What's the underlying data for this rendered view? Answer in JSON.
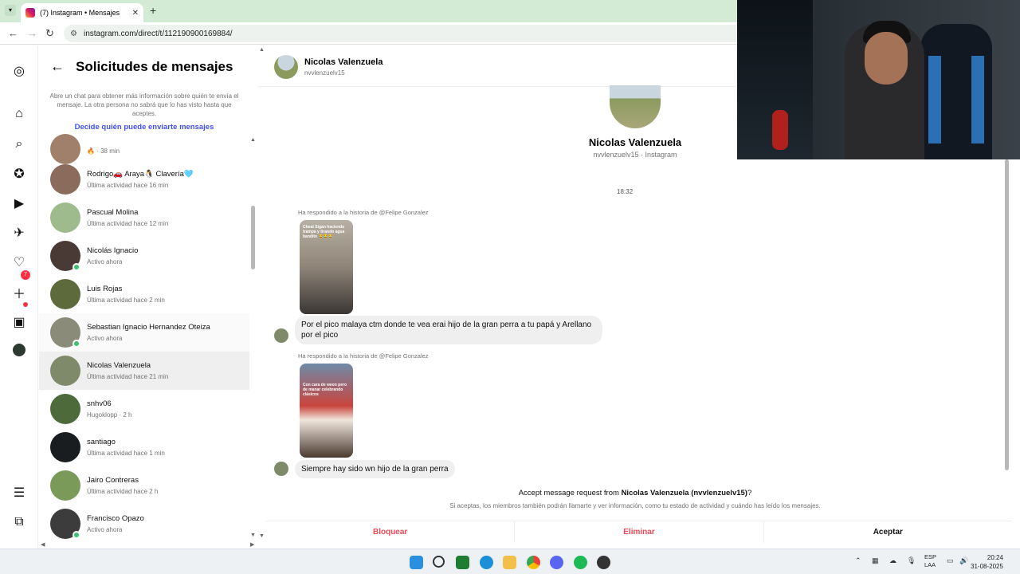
{
  "browser": {
    "tab_title": "(7) Instagram • Mensajes",
    "url": "instagram.com/direct/t/112190900169884/",
    "new_tab_symbol": "+",
    "tab_close_symbol": "✕"
  },
  "rail": {
    "notification_badge": "7"
  },
  "requests": {
    "title": "Solicitudes de mensajes",
    "info": "Abre un chat para obtener más información sobre quién te envía el mensaje. La otra persona no sabrá que lo has visto hasta que aceptes.",
    "link": "Decide quién puede enviarte mensajes",
    "items": [
      {
        "name": "",
        "sub": "🔥 · 38 min",
        "online": false,
        "color": "#a0806a"
      },
      {
        "name": "Rodrigo🚗 Araya🐧 Clavería🩵",
        "sub": "Última actividad hace 16 min",
        "online": false,
        "color": "#8a6b5c"
      },
      {
        "name": "Pascual Molina",
        "sub": "Última actividad hace 12 min",
        "online": false,
        "color": "#9dbb8c"
      },
      {
        "name": "Nicolás Ignacio",
        "sub": "Activo ahora",
        "online": true,
        "color": "#4a3a36"
      },
      {
        "name": "Luis Rojas",
        "sub": "Última actividad hace 2 min",
        "online": false,
        "color": "#5d6b3c"
      },
      {
        "name": "Sebastian Ignacio Hernandez Oteiza",
        "sub": "Activo ahora",
        "online": true,
        "color": "#8b8b7a"
      },
      {
        "name": "Nicolas Valenzuela",
        "sub": "Última actividad hace 21 min",
        "online": false,
        "color": "#7f8a6a"
      },
      {
        "name": "snhv06",
        "sub": "Hugoklopp · 2 h",
        "online": false,
        "color": "#4d6b3a"
      },
      {
        "name": "santiago",
        "sub": "Última actividad hace 1 min",
        "online": false,
        "color": "#1a1d1f"
      },
      {
        "name": "Jairo Contreras",
        "sub": "Última actividad hace 2 h",
        "online": false,
        "color": "#7a9a5a"
      },
      {
        "name": "Francisco Opazo",
        "sub": "Activo ahora",
        "online": true,
        "color": "#3c3c3c"
      }
    ]
  },
  "chat": {
    "name": "Nicolas Valenzuela",
    "username": "nvvlenzuelv15",
    "profile_sub": "nvvlenzuelv15 · Instagram",
    "time": "18:32",
    "story_label_1": "Ha respondido a la historia de @Felipe Gonzalez",
    "story_caption_1": "Cheat Sigan haciendo trampa y tirando agua bandito 😂😂😂",
    "message_1": "Por el pico malaya ctm donde te vea erai hijo de la gran perra a tu papá y Arellano por el pico",
    "story_label_2": "Ha respondido a la historia de @Felipe Gonzalez",
    "story_caption_2": "Con cara de weon pero de manar celebrando clásicos",
    "message_2": "Siempre hay sido wn hijo de la gran perra",
    "accept_prefix": "Accept message request from ",
    "accept_name": "Nicolas Valenzuela (nvvlenzuelv15)",
    "accept_suffix": "?",
    "accept_sub": "Si aceptas, los miembros también podrán llamarte y ver información, como tu estado de actividad y cuándo has leído los mensajes.",
    "btn_block": "Bloquear",
    "btn_delete": "Eliminar",
    "btn_accept": "Aceptar"
  },
  "taskbar": {
    "lang_1": "ESP",
    "lang_2": "LAA",
    "time": "20:24",
    "date": "31-08-2025"
  },
  "colors": {
    "accent_link": "#4150f7",
    "danger": "#ed4956",
    "online": "#38c172"
  }
}
